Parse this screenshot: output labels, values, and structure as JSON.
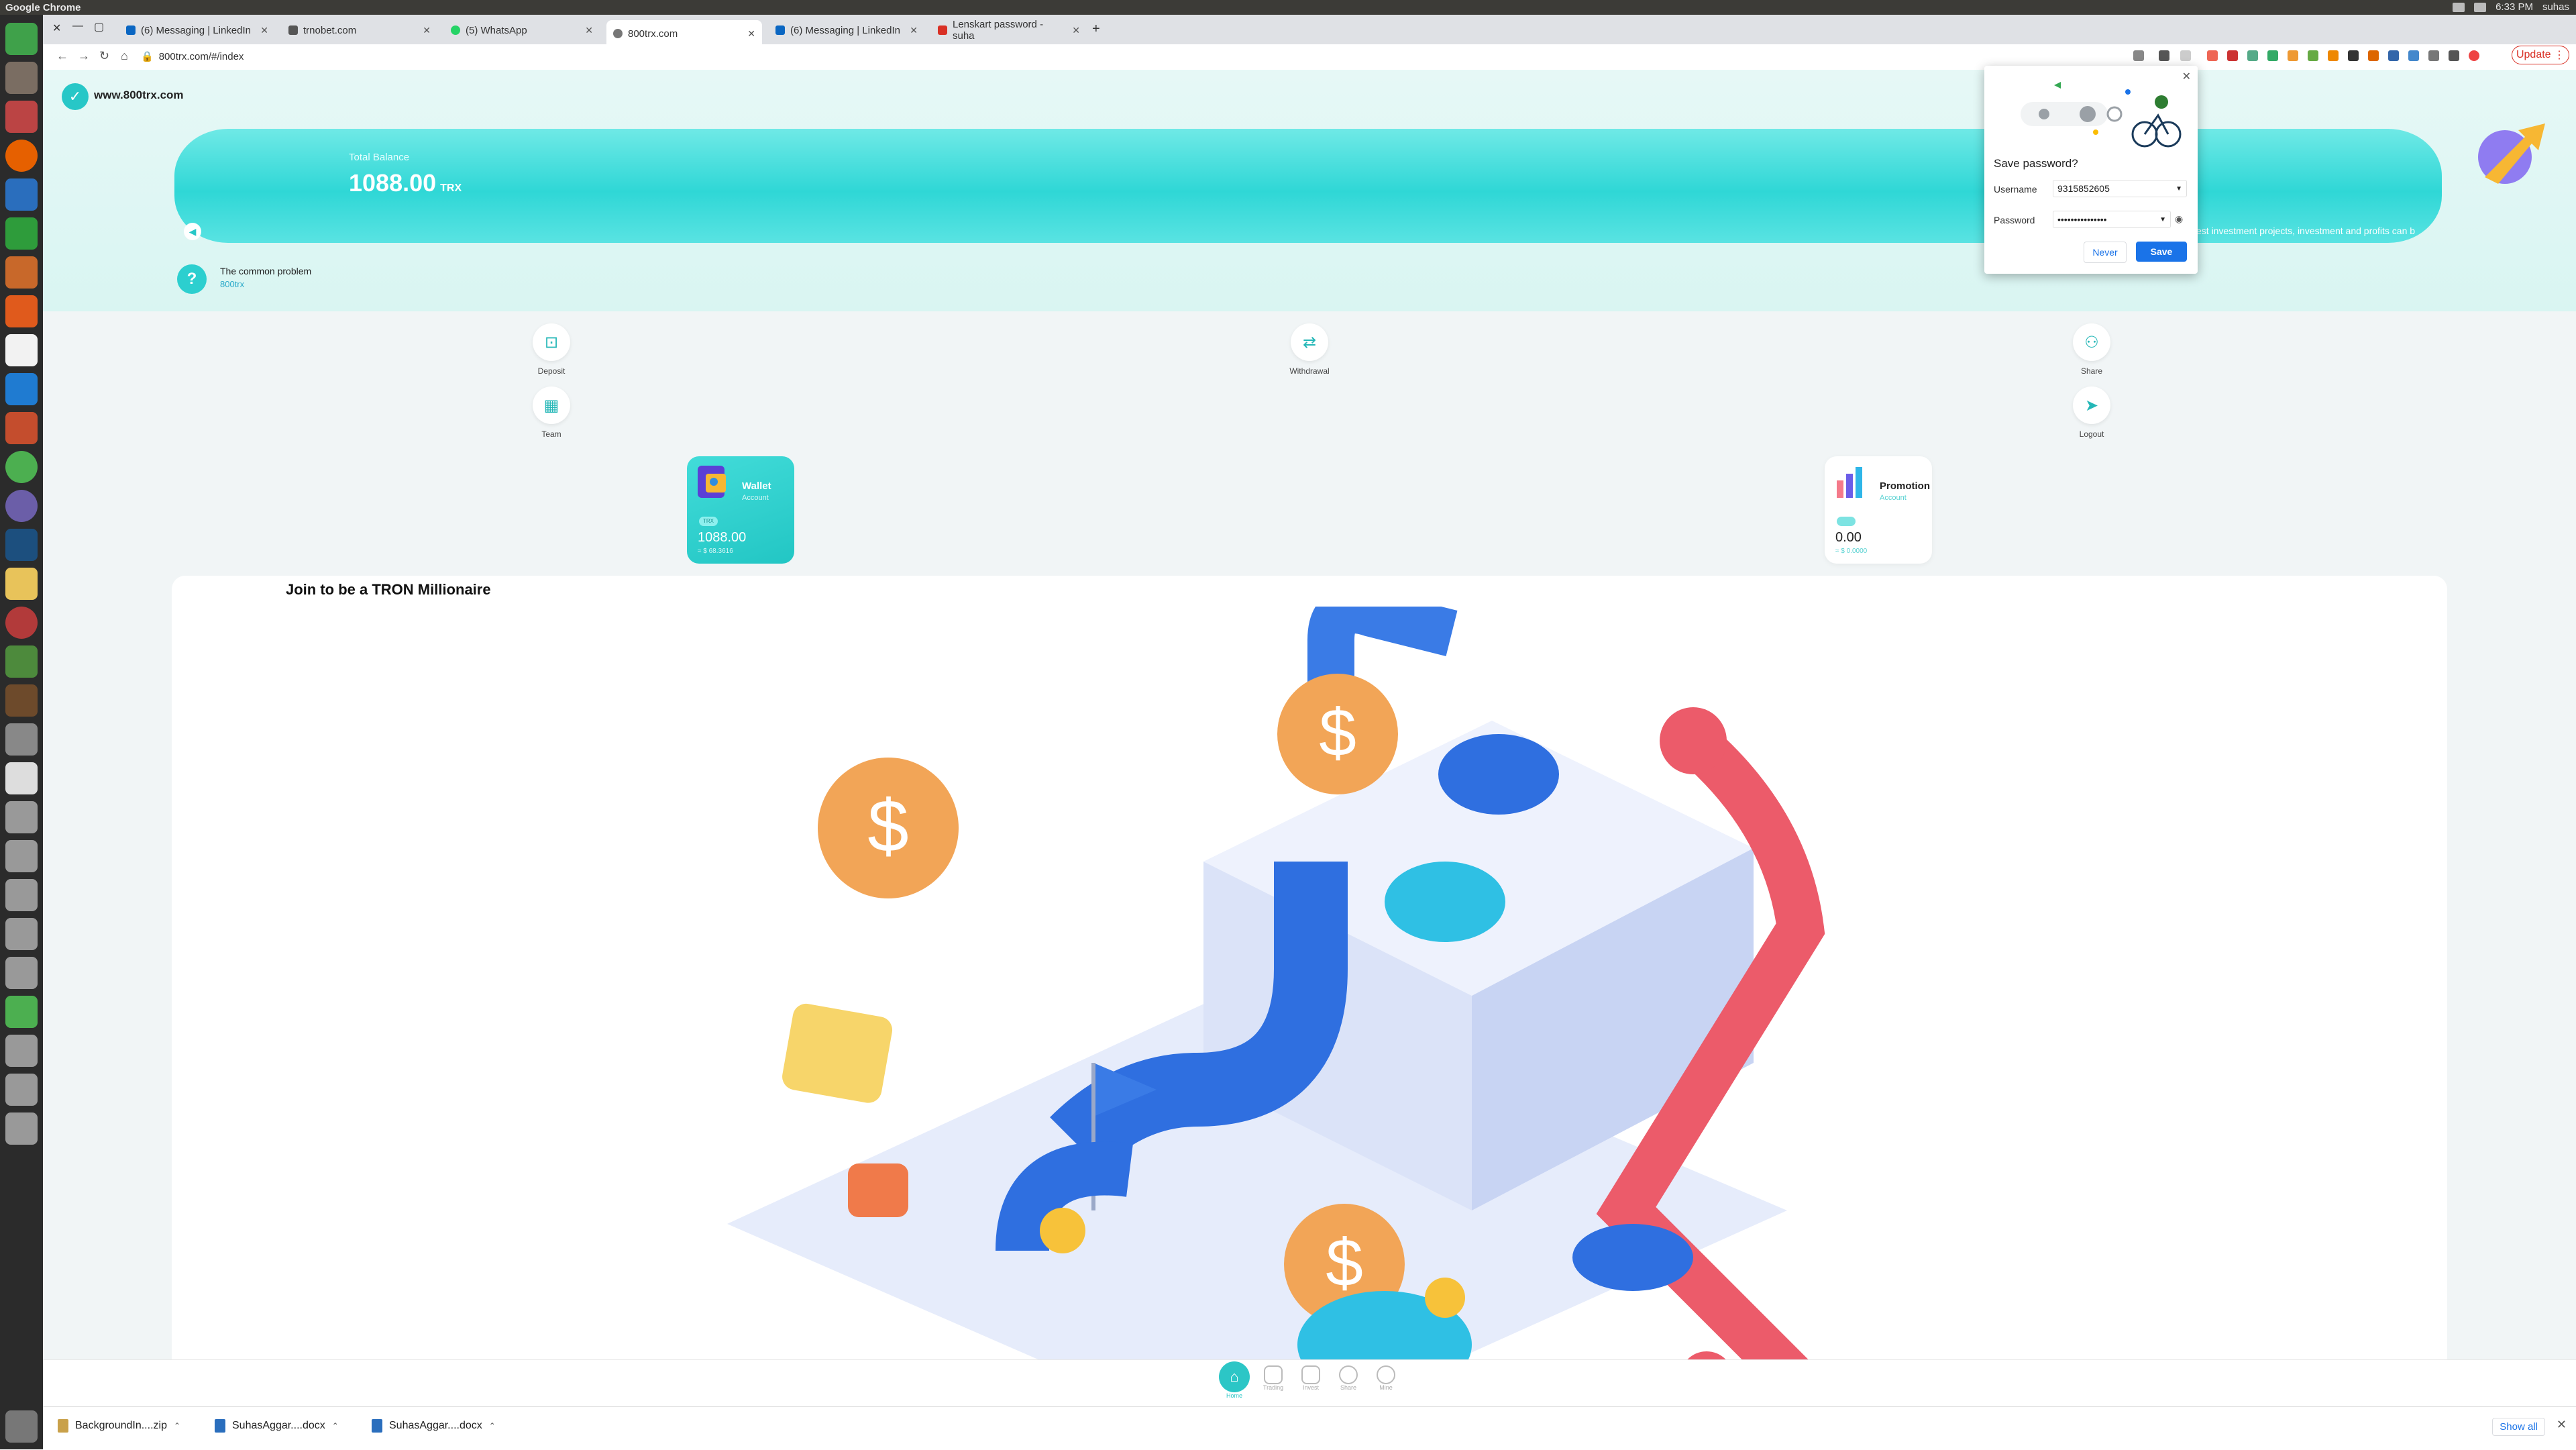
{
  "system_bar": {
    "app_name": "Google Chrome",
    "time": "6:33 PM",
    "user": "suhas"
  },
  "browser": {
    "tabs": [
      {
        "label": "(6) Messaging | LinkedIn",
        "favicon_color": "#0a66c2"
      },
      {
        "label": "trnobet.com",
        "favicon_color": "#555555"
      },
      {
        "label": "(5) WhatsApp",
        "favicon_color": "#25d366"
      },
      {
        "label": "800trx.com",
        "favicon_color": "#777777"
      },
      {
        "label": "(6) Messaging | LinkedIn",
        "favicon_color": "#0a66c2"
      },
      {
        "label": "Lenskart password - suha",
        "favicon_color": "#d93025"
      }
    ],
    "new_tab": "+",
    "url": "800trx.com/#/index",
    "update_label": "Update"
  },
  "site": {
    "logo_glyph": "✓",
    "name": "www.800trx.com",
    "balance_label": "Total Balance",
    "balance_value": "1088.00",
    "balance_unit": "TRX",
    "marquee_text": "est investment projects, investment and profits can b",
    "help_title": "The common problem",
    "help_link": "800trx",
    "actions": [
      {
        "label": "Deposit",
        "icon": "deposit-icon"
      },
      {
        "label": "Withdrawal",
        "icon": "withdrawal-icon"
      },
      {
        "label": "Share",
        "icon": "share-icon"
      },
      {
        "label": "Team",
        "icon": "team-icon"
      },
      {
        "label": "Logout",
        "icon": "logout-icon"
      }
    ],
    "wallet": {
      "title": "Wallet",
      "subtitle": "Account",
      "chip": "TRX",
      "amount": "1088.00",
      "note": "≈ $ 68.3616"
    },
    "promotion": {
      "title": "Promotion",
      "subtitle": "Account",
      "amount": "0.00",
      "note": "≈ $ 0.0000"
    },
    "join_title": "Join to be a TRON Millionaire",
    "bottom_nav": [
      {
        "label": "Home",
        "active": true
      },
      {
        "label": "Trading",
        "active": false
      },
      {
        "label": "Invest",
        "active": false
      },
      {
        "label": "Share",
        "active": false
      },
      {
        "label": "Mine",
        "active": false
      }
    ]
  },
  "password_popup": {
    "title": "Save password?",
    "username_label": "Username",
    "username_value": "9315852605",
    "password_label": "Password",
    "password_value": "•••••••••••••••",
    "never_label": "Never",
    "save_label": "Save"
  },
  "downloads": {
    "items": [
      {
        "name": "BackgroundIn....zip"
      },
      {
        "name": "SuhasAggar....docx"
      },
      {
        "name": "SuhasAggar....docx"
      }
    ],
    "show_all": "Show all"
  }
}
